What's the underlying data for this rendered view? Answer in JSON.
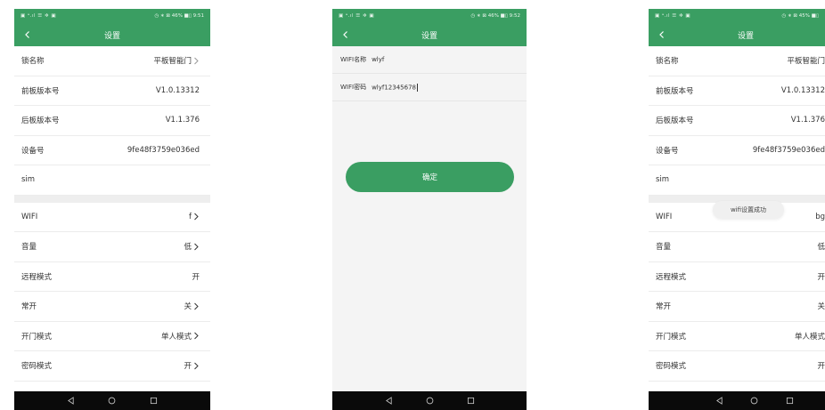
{
  "colors": {
    "brand_green": "#3a9e62",
    "nav_black": "#0a0a0a"
  },
  "phone1": {
    "status": {
      "left": "▣ ᵊ.ıl ☰ ✲ ▣",
      "right": "◷ ∗ ⊠ 46% ■▯ 9:51"
    },
    "title": "设置",
    "rows": [
      {
        "label": "锁名称",
        "value": "平板智能门",
        "chevron": true
      },
      {
        "label": "前板版本号",
        "value": "V1.0.13312"
      },
      {
        "label": "后板版本号",
        "value": "V1.1.376"
      },
      {
        "label": "设备号",
        "value": "9fe48f3759e036ed"
      },
      {
        "label": "sim",
        "value": ""
      }
    ],
    "rows2": [
      {
        "label": "WIFI",
        "value": "f",
        "chevron": true
      },
      {
        "label": "音量",
        "value": "低",
        "chevron": true
      },
      {
        "label": "远程模式",
        "value": "开"
      },
      {
        "label": "常开",
        "value": "关",
        "chevron": true
      },
      {
        "label": "开门模式",
        "value": "单人模式",
        "chevron": true
      },
      {
        "label": "密码模式",
        "value": "开",
        "chevron": true
      }
    ]
  },
  "phone2": {
    "status": {
      "left": "▣ ᵊ.ıl ☰ ✲ ▣",
      "right": "◷ ∗ ⊠ 46% ■▯ 9:52"
    },
    "title": "设置",
    "wifi_name_label": "WIFI名称",
    "wifi_name_value": "wlyf",
    "wifi_pwd_label": "WIFI密码",
    "wifi_pwd_value": "wlyf12345678",
    "confirm_label": "确定"
  },
  "phone3": {
    "status": {
      "left": "▣ ᵊ.ıl ☰ ✲ ▣",
      "right": "◷ ∗ ⊠ 45% ■▯"
    },
    "title": "设置",
    "rows": [
      {
        "label": "锁名称",
        "value": "平板智能门"
      },
      {
        "label": "前板版本号",
        "value": "V1.0.13312"
      },
      {
        "label": "后板版本号",
        "value": "V1.1.376"
      },
      {
        "label": "设备号",
        "value": "9fe48f3759e036ed"
      },
      {
        "label": "sim",
        "value": ""
      }
    ],
    "rows2": [
      {
        "label": "WIFI",
        "value": "bg"
      },
      {
        "label": "音量",
        "value": "低"
      },
      {
        "label": "远程模式",
        "value": "开"
      },
      {
        "label": "常开",
        "value": "关"
      },
      {
        "label": "开门模式",
        "value": "单人模式"
      },
      {
        "label": "密码模式",
        "value": "开"
      }
    ],
    "toast": "wifi设置成功"
  }
}
